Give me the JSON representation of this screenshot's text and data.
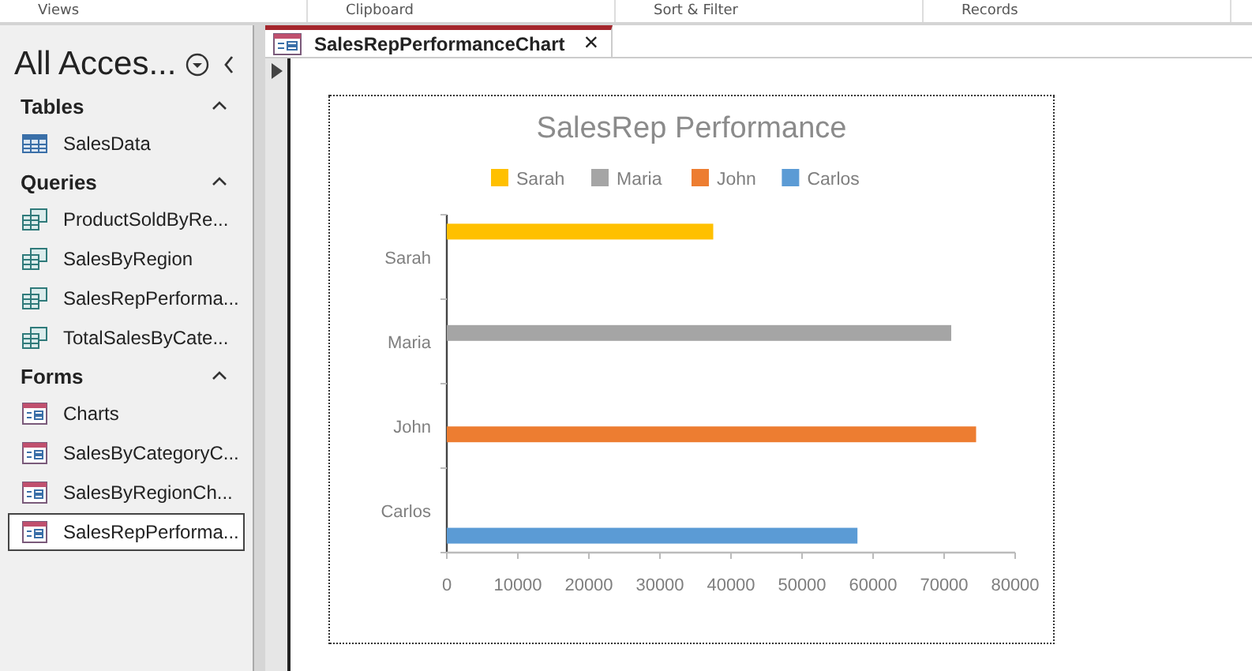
{
  "ribbon_groups": [
    "Views",
    "Clipboard",
    "Sort & Filter",
    "Records"
  ],
  "navigation": {
    "title": "All Acces...",
    "groups": [
      {
        "label": "Tables",
        "expanded": true,
        "items": [
          {
            "label": "SalesData",
            "kind": "table",
            "selected": false
          }
        ]
      },
      {
        "label": "Queries",
        "expanded": true,
        "items": [
          {
            "label": "ProductSoldByRe...",
            "kind": "query",
            "selected": false
          },
          {
            "label": "SalesByRegion",
            "kind": "query",
            "selected": false
          },
          {
            "label": "SalesRepPerforma...",
            "kind": "query",
            "selected": false
          },
          {
            "label": "TotalSalesByCate...",
            "kind": "query",
            "selected": false
          }
        ]
      },
      {
        "label": "Forms",
        "expanded": true,
        "items": [
          {
            "label": "Charts",
            "kind": "form",
            "selected": false
          },
          {
            "label": "SalesByCategoryC...",
            "kind": "form",
            "selected": false
          },
          {
            "label": "SalesByRegionCh...",
            "kind": "form",
            "selected": false
          },
          {
            "label": "SalesRepPerforma...",
            "kind": "form",
            "selected": true
          }
        ]
      }
    ]
  },
  "tabs": [
    {
      "label": "SalesRepPerformanceChart",
      "selected": true,
      "close": "×"
    }
  ],
  "chart_data": {
    "type": "bar",
    "orientation": "horizontal",
    "title": "SalesRep Performance",
    "legend": "top",
    "categories": [
      "Sarah",
      "Maria",
      "John",
      "Carlos"
    ],
    "series": [
      {
        "name": "Sarah",
        "color": "#ffc000",
        "values": [
          37500,
          null,
          null,
          null
        ]
      },
      {
        "name": "Maria",
        "color": "#a5a5a5",
        "values": [
          null,
          71000,
          null,
          null
        ]
      },
      {
        "name": "John",
        "color": "#ed7d31",
        "values": [
          null,
          null,
          74500,
          null
        ]
      },
      {
        "name": "Carlos",
        "color": "#5b9bd5",
        "values": [
          null,
          null,
          null,
          57800
        ]
      }
    ],
    "xlim": [
      0,
      80000
    ],
    "xticks": [
      0,
      10000,
      20000,
      30000,
      40000,
      50000,
      60000,
      70000,
      80000
    ]
  }
}
